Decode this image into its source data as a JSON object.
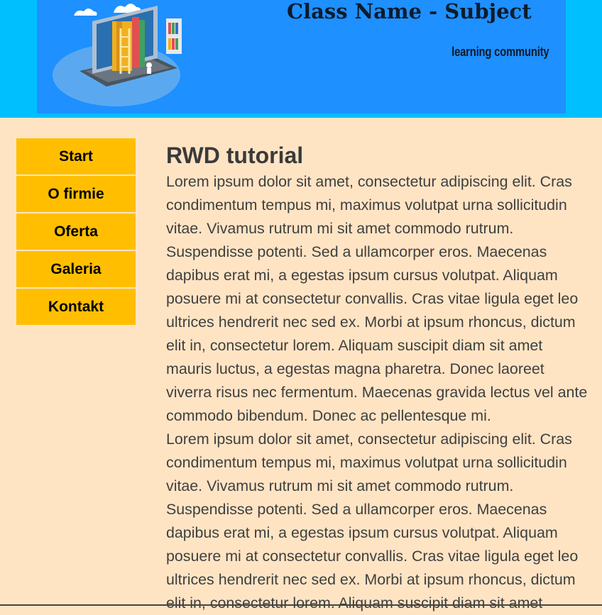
{
  "header": {
    "title": "Class Name - Subject",
    "subtitle": "learning community",
    "illustration_icon": "laptop-books-illustration"
  },
  "nav": {
    "items": [
      {
        "label": "Start"
      },
      {
        "label": "O firmie"
      },
      {
        "label": "Oferta"
      },
      {
        "label": "Galeria"
      },
      {
        "label": "Kontakt"
      }
    ]
  },
  "main": {
    "heading": "RWD tutorial",
    "paragraphs": [
      "Lorem ipsum dolor sit amet, consectetur adipiscing elit. Cras condimentum tempus mi, maximus volutpat urna sollicitudin vitae. Vivamus rutrum mi sit amet commodo rutrum. Suspendisse potenti. Sed a ullamcorper eros. Maecenas dapibus erat mi, a egestas ipsum cursus volutpat. Aliquam posuere mi at consectetur convallis. Cras vitae ligula eget leo ultrices hendrerit nec sed ex. Morbi at ipsum rhoncus, dictum elit in, consectetur lorem. Aliquam suscipit diam sit amet mauris luctus, a egestas magna pharetra. Donec laoreet viverra risus nec fermentum. Maecenas gravida lectus vel ante commodo bibendum. Donec ac pellentesque mi.",
      "Lorem ipsum dolor sit amet, consectetur adipiscing elit. Cras condimentum tempus mi, maximus volutpat urna sollicitudin vitae. Vivamus rutrum mi sit amet commodo rutrum. Suspendisse potenti. Sed a ullamcorper eros. Maecenas dapibus erat mi, a egestas ipsum cursus volutpat. Aliquam posuere mi at consectetur convallis. Cras vitae ligula eget leo ultrices hendrerit nec sed ex. Morbi at ipsum rhoncus, dictum elit in, consectetur lorem. Aliquam suscipit diam sit amet"
    ]
  },
  "colors": {
    "page_background": "#ffe4c4",
    "header_background": "#00bfff",
    "banner_background": "#1e90ff",
    "nav_background": "#ffbf00"
  }
}
